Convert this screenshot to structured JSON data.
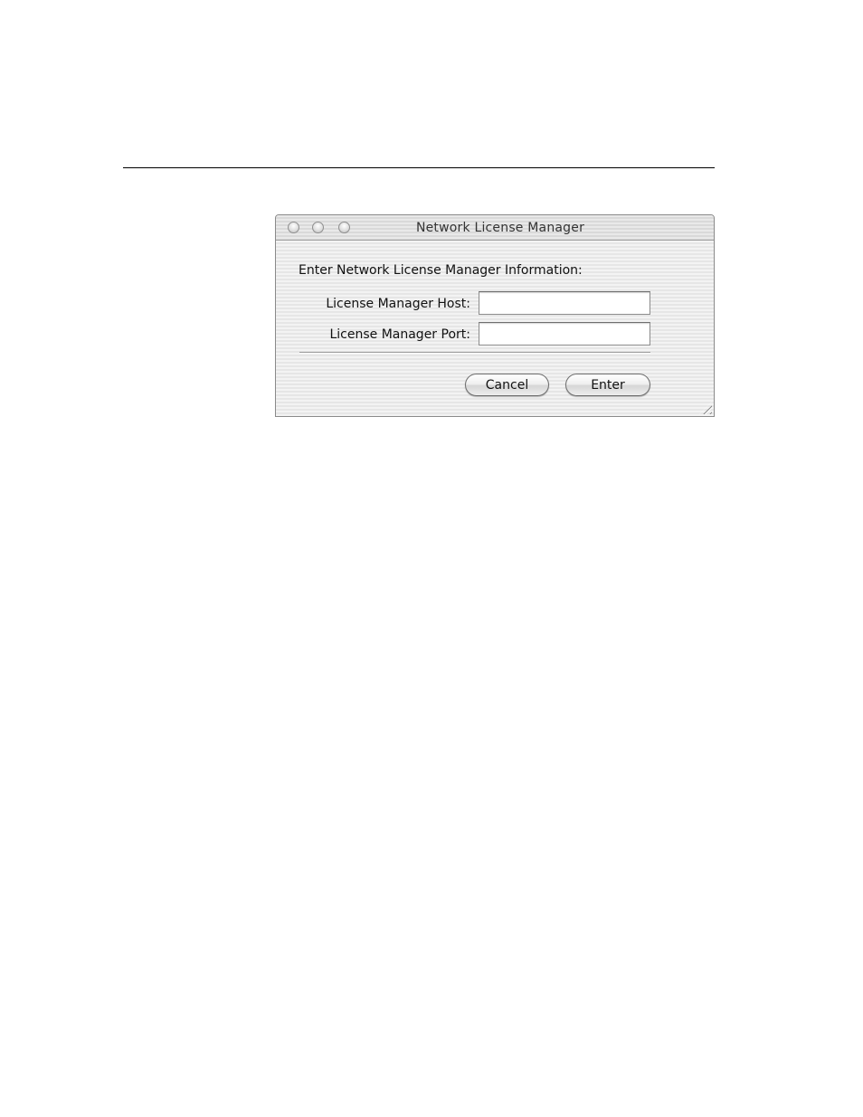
{
  "window": {
    "title": "Network License Manager"
  },
  "form": {
    "intro": "Enter Network License Manager Information:",
    "host_label": "License Manager Host:",
    "host_value": "",
    "port_label": "License Manager Port:",
    "port_value": ""
  },
  "buttons": {
    "cancel": "Cancel",
    "enter": "Enter"
  },
  "icons": {
    "close": "close-icon",
    "minimize": "minimize-icon",
    "zoom": "zoom-icon",
    "resize": "resize-grip-icon"
  }
}
